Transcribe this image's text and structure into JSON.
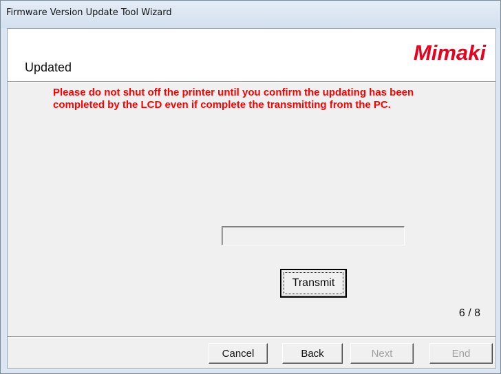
{
  "window": {
    "title": "Firmware Version Update Tool Wizard"
  },
  "header": {
    "title": "Updated",
    "logo_text": "Mimaki",
    "logo_color": "#e8001c"
  },
  "main": {
    "warning": "Please do not shut off the printer until you confirm the updating has been completed by the LCD even if complete the transmitting from the PC.",
    "warning_color": "#ff0000",
    "progress_value": 0,
    "transmit_label": "Transmit",
    "pager": "6 / 8"
  },
  "footer": {
    "cancel_label": "Cancel",
    "back_label": "Back",
    "next_label": "Next",
    "end_label": "End"
  }
}
